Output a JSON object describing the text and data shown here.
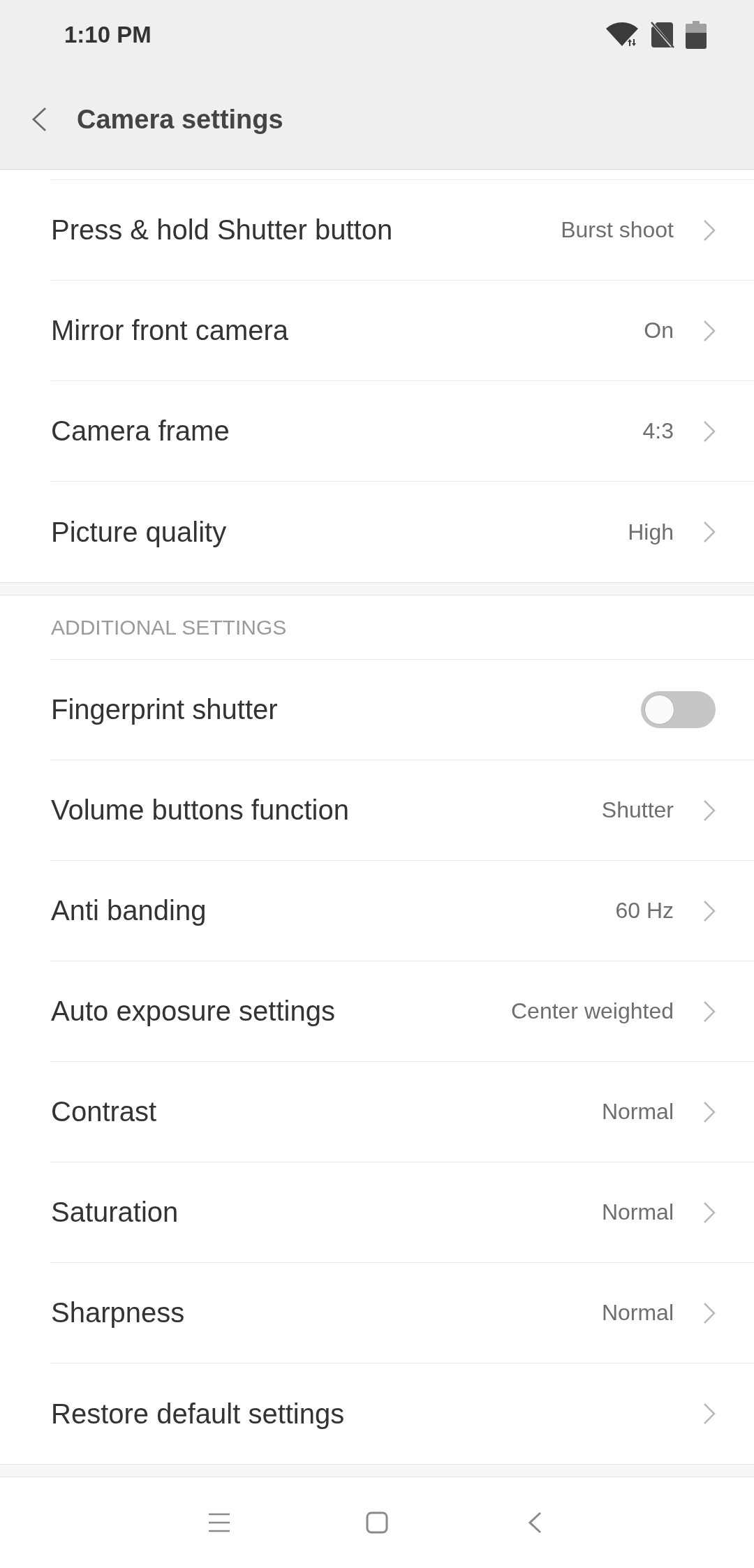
{
  "status_bar": {
    "time": "1:10 PM"
  },
  "header": {
    "title": "Camera settings"
  },
  "sections": [
    {
      "items": [
        {
          "kind": "value",
          "label": "Press & hold Shutter button",
          "value": "Burst shoot"
        },
        {
          "kind": "value",
          "label": "Mirror front camera",
          "value": "On"
        },
        {
          "kind": "value",
          "label": "Camera frame",
          "value": "4:3"
        },
        {
          "kind": "value",
          "label": "Picture quality",
          "value": "High"
        }
      ]
    },
    {
      "heading": "ADDITIONAL SETTINGS",
      "items": [
        {
          "kind": "toggle",
          "label": "Fingerprint shutter",
          "on": false
        },
        {
          "kind": "value",
          "label": "Volume buttons function",
          "value": "Shutter"
        },
        {
          "kind": "value",
          "label": "Anti banding",
          "value": "60 Hz"
        },
        {
          "kind": "value",
          "label": "Auto exposure settings",
          "value": "Center weighted"
        },
        {
          "kind": "value",
          "label": "Contrast",
          "value": "Normal"
        },
        {
          "kind": "value",
          "label": "Saturation",
          "value": "Normal"
        },
        {
          "kind": "value",
          "label": "Sharpness",
          "value": "Normal"
        },
        {
          "kind": "link",
          "label": "Restore default settings"
        }
      ]
    }
  ]
}
